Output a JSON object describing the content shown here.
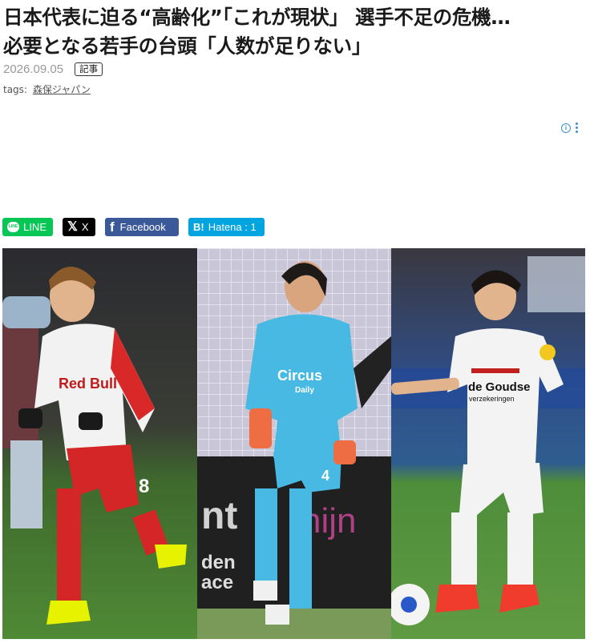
{
  "article": {
    "title_line1": "日本代表に迫る“高齢化”「これが現状」 選手不足の危機…",
    "title_line2": "必要となる若手の台頭「人数が足りない」",
    "date": "2026.09.05",
    "category_badge": "記事",
    "tags_label": "tags:",
    "tags": [
      "森保ジャパン"
    ]
  },
  "ad": {
    "info_icon": "info-icon",
    "more_icon": "vertical-dots-icon"
  },
  "share": {
    "line_label": "LINE",
    "x_label": "X",
    "facebook_label": "Facebook",
    "hatena_label": "Hatena : 1",
    "colors": {
      "line": "#06c755",
      "x": "#000000",
      "facebook": "#3b5998",
      "hatena": "#00a4de"
    }
  },
  "photo": {
    "panels": [
      {
        "name": "player-redbull",
        "shirt_text": "Red Bull",
        "number": "8"
      },
      {
        "name": "goalkeeper-circus",
        "shirt_text": "Circus",
        "shirt_subtext": "Daily",
        "number": "4"
      },
      {
        "name": "player-white-kit",
        "shirt_text": "de Goudse",
        "shirt_subtext": "verzekeringen"
      }
    ]
  }
}
